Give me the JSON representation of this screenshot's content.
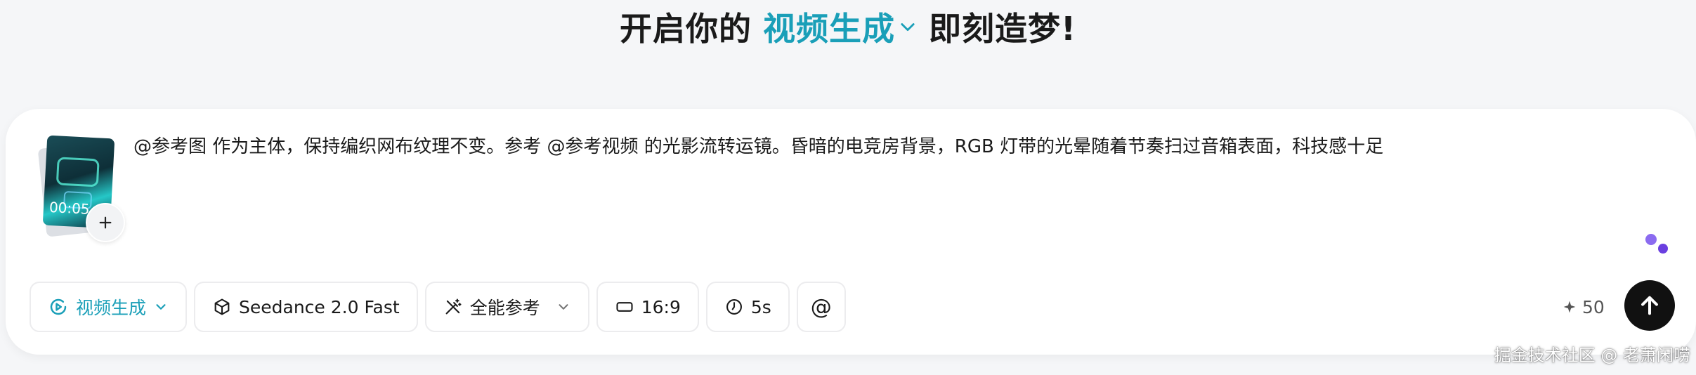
{
  "headline": {
    "prefix": "开启你的",
    "mode": "视频生成",
    "suffix": "即刻造梦!"
  },
  "thumbnail": {
    "timecode": "00:05"
  },
  "prompt": {
    "text": "@参考图 作为主体，保持编织网布纹理不变。参考 @参考视频 的光影流转运镜。昏暗的电竞房背景，RGB 灯带的光晕随着节奏扫过音箱表面，科技感十足"
  },
  "toolbar": {
    "mode_label": "视频生成",
    "model_label": "Seedance 2.0 Fast",
    "reference_label": "全能参考",
    "ratio_label": "16:9",
    "duration_label": "5s",
    "mention_label": "@"
  },
  "credits": {
    "value": "50"
  },
  "colors": {
    "accent": "#1a9fb8",
    "send": "#111111",
    "dot_primary": "#8b6bf0"
  },
  "icons": [
    "chevron-down-icon",
    "video-play-icon",
    "cube-icon",
    "magic-wand-icon",
    "aspect-ratio-icon",
    "clock-icon",
    "sparkle-icon",
    "arrow-up-icon",
    "plus-icon"
  ],
  "watermark": "掘金技术社区 @ 老萧闲唠"
}
